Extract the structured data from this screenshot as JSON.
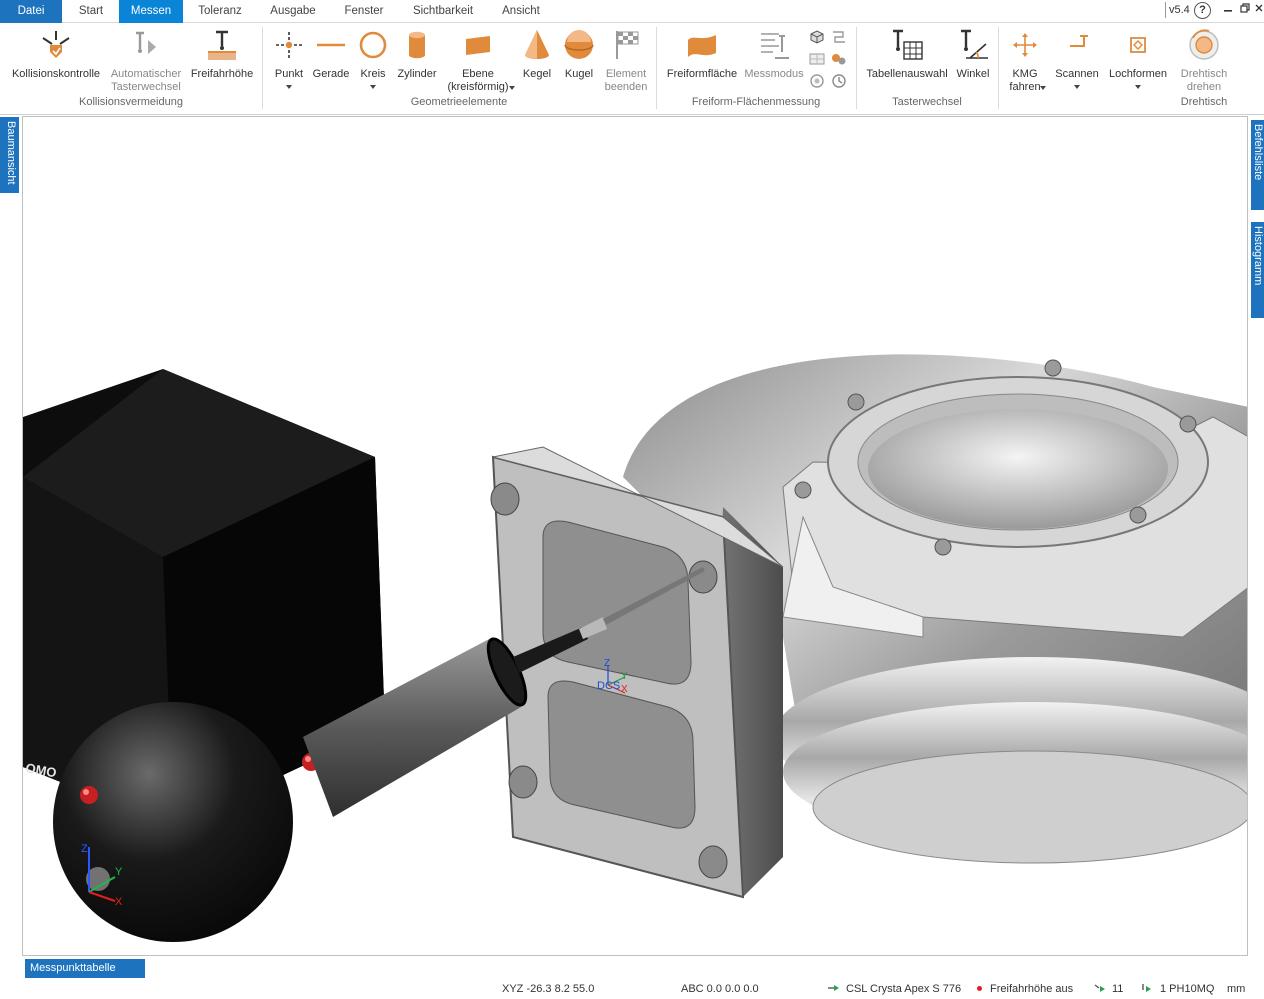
{
  "menu": {
    "tabs": [
      {
        "label": "Datei"
      },
      {
        "label": "Start"
      },
      {
        "label": "Messen"
      },
      {
        "label": "Toleranz"
      },
      {
        "label": "Ausgabe"
      },
      {
        "label": "Fenster"
      },
      {
        "label": "Sichtbarkeit"
      },
      {
        "label": "Ansicht"
      }
    ],
    "version": "v5.4",
    "help_glyph": "?"
  },
  "ribbon": {
    "groups": [
      {
        "label": "Kollisionsvermeidung"
      },
      {
        "label": "Geometrieelemente"
      },
      {
        "label": "Freiform-Flächenmessung"
      },
      {
        "label": "Tasterwechsel"
      },
      {
        "label": "Drehtisch"
      }
    ],
    "buttons": [
      {
        "label": "Kollisionskontrolle",
        "icon": "collision-check-icon"
      },
      {
        "label": "Automatischer",
        "label2": "Tasterwechsel",
        "icon": "auto-probe-change-icon"
      },
      {
        "label": "Freifahrhöhe",
        "icon": "clearance-height-icon"
      },
      {
        "label": "Punkt",
        "icon": "point-icon"
      },
      {
        "label": "Gerade",
        "icon": "line-icon"
      },
      {
        "label": "Kreis",
        "icon": "circle-icon"
      },
      {
        "label": "Zylinder",
        "icon": "cylinder-icon"
      },
      {
        "label": "Ebene",
        "label2": "(kreisförmig)",
        "icon": "plane-icon"
      },
      {
        "label": "Kegel",
        "icon": "cone-icon"
      },
      {
        "label": "Kugel",
        "icon": "sphere-icon"
      },
      {
        "label": "Element",
        "label2": "beenden",
        "icon": "finish-flag-icon"
      },
      {
        "label": "Freiformfläche",
        "icon": "freeform-surface-icon"
      },
      {
        "label": "Messmodus",
        "icon": "measure-mode-icon"
      },
      {
        "label": "Tabellenauswahl",
        "icon": "table-select-icon"
      },
      {
        "label": "Winkel",
        "icon": "angle-icon"
      },
      {
        "label": "KMG",
        "label2": "fahren",
        "icon": "cmm-move-icon"
      },
      {
        "label": "Scannen",
        "icon": "scan-icon"
      },
      {
        "label": "Lochformen",
        "icon": "hole-shapes-icon"
      },
      {
        "label": "Drehtisch",
        "label2": "drehen",
        "icon": "rotary-table-icon"
      }
    ]
  },
  "side_tabs": {
    "left": "Baumansicht",
    "right_top": "Befehlsliste",
    "right_bottom": "Histogramm"
  },
  "viewport": {
    "triad_labels": {
      "z": "Z",
      "y": "Y",
      "x": "X"
    },
    "dcs_label": "DCS",
    "dcs_axes": {
      "z": "Z",
      "y": "Y",
      "x": "X"
    },
    "machine_label": "OMO"
  },
  "bottom_tab": "Messpunkttabelle",
  "status": {
    "xyz": "XYZ -26.3 8.2 55.0",
    "abc": "ABC 0.0 0.0 0.0",
    "machine": "CSL Crysta Apex S 776",
    "clearance": "Freifahrhöhe aus",
    "count": "11",
    "probe": "1 PH10MQ",
    "unit": "mm"
  },
  "colors": {
    "accent": "#1e73be",
    "active_tab": "#0a84d6",
    "icon_orange": "#e08a3c"
  }
}
